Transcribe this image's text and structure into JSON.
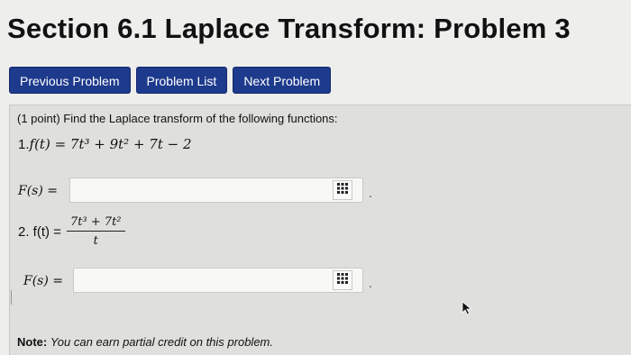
{
  "page": {
    "title": "Section 6.1 Laplace Transform: Problem 3"
  },
  "nav": {
    "previous": "Previous Problem",
    "list": "Problem List",
    "next": "Next Problem"
  },
  "problem": {
    "intro": "(1 point) Find the Laplace transform of the following functions:",
    "part1": {
      "number": "1.",
      "function": "f(t) = 7t³ + 9t² + 7t − 2",
      "answer_label": "F(s) =",
      "answer_value": ""
    },
    "part2": {
      "label": "2. f(t) =",
      "numerator": "7t³ + 7t²",
      "denominator": "t",
      "answer_label": "F(s) =",
      "answer_value": ""
    },
    "answer_suffix": ".",
    "note_label": "Note:",
    "note_text": "You can earn partial credit on this problem."
  },
  "icons": {
    "equation_editor": "grid-icon",
    "mouse_pointer": "cursor-arrow-icon"
  }
}
